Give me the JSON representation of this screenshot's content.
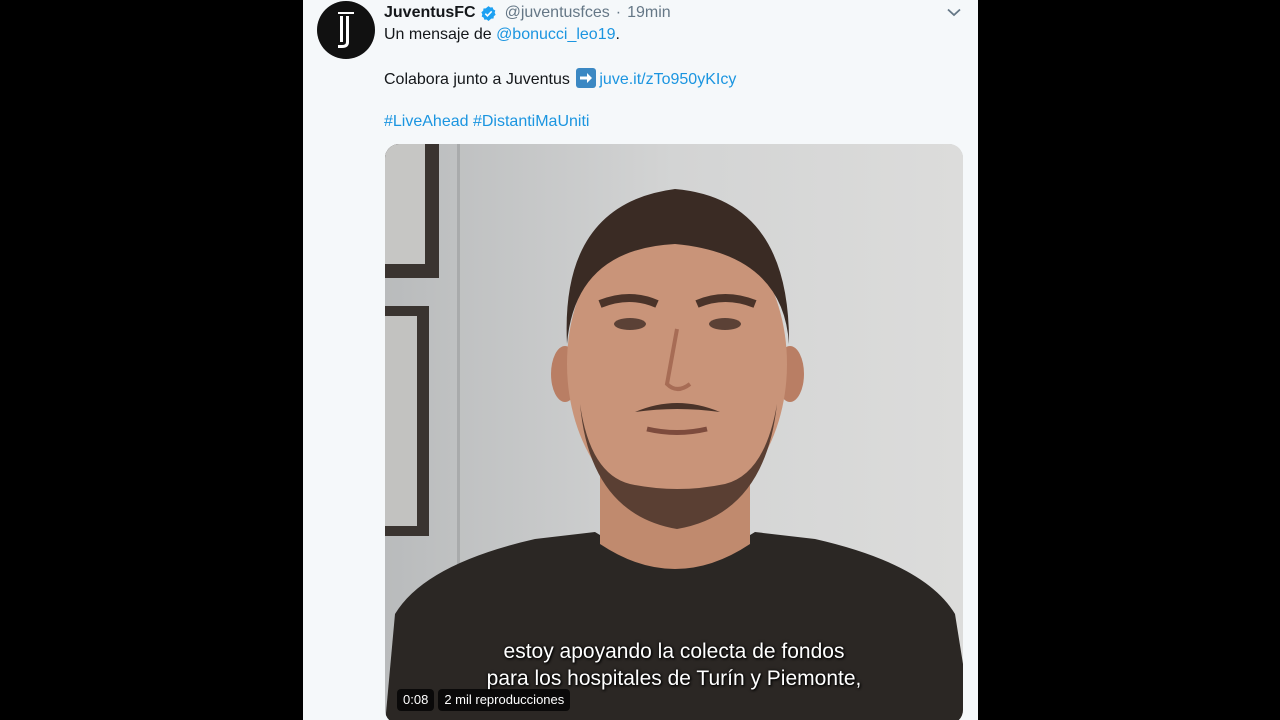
{
  "tweet": {
    "display_name": "JuventusFC",
    "handle": "@juventusfces",
    "separator": "·",
    "time": "19min",
    "line1_prefix": "Un mensaje de ",
    "line1_mention": "@bonucci_leo19",
    "line1_suffix": ".",
    "line2_prefix": "Colabora junto a Juventus",
    "line2_link": "juve.it/zTo950yKIcy",
    "hashtag1": "#LiveAhead",
    "hashtag2": "#DistantiMaUniti"
  },
  "video": {
    "subtitle_line1": "estoy apoyando la colecta de fondos",
    "subtitle_line2": "para los hospitales de Turín y Piemonte,",
    "duration": "0:08",
    "views": "2 mil reproducciones"
  },
  "icons": {
    "avatar": "juventus-logo",
    "verified": "verified-badge-icon",
    "caret": "chevron-down-icon",
    "arrow": "right-arrow-emoji-icon"
  },
  "colors": {
    "link": "#1b95e0",
    "verified": "#1da1f2",
    "panel_bg": "#f5f8fa",
    "page_bg": "#000000"
  }
}
